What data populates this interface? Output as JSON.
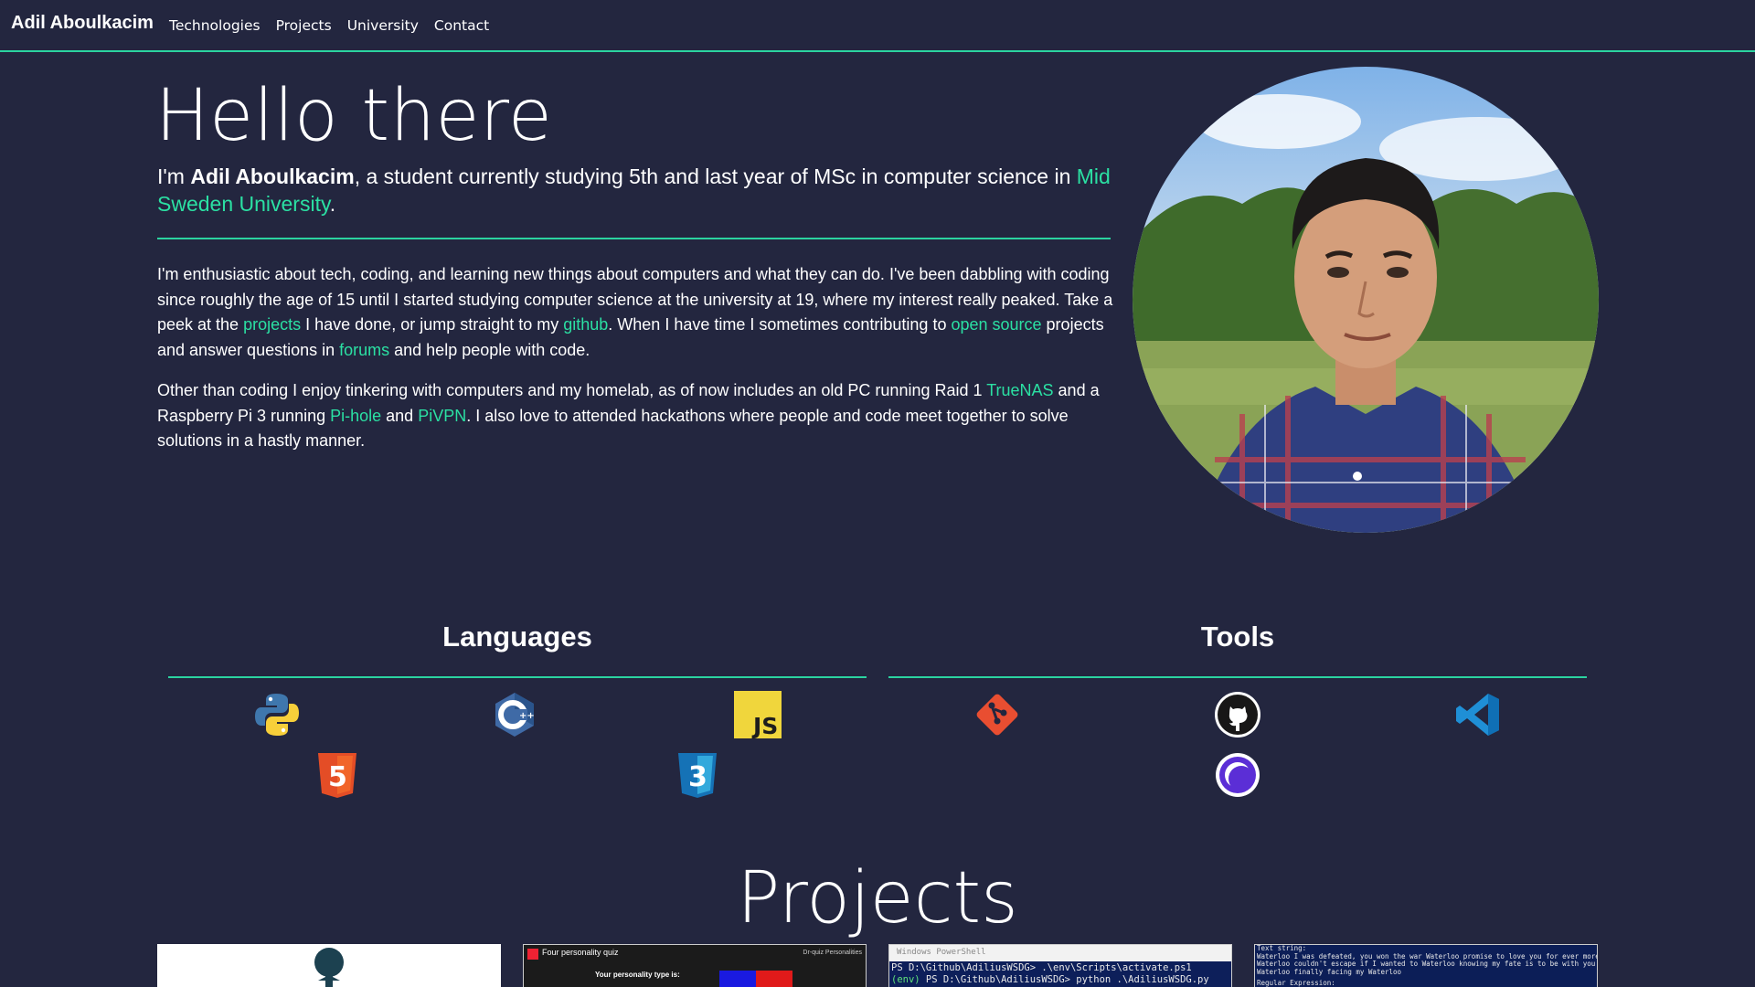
{
  "nav": {
    "brand": "Adil Aboulkacim",
    "links": [
      "Technologies",
      "Projects",
      "University",
      "Contact"
    ]
  },
  "hero": {
    "title": "Hello there",
    "sub_prefix": "I'm ",
    "sub_name": "Adil Aboulkacim",
    "sub_mid": ", a student currently studying 5th and last year of MSc in computer science in ",
    "sub_link": "Mid Sweden University",
    "sub_end": "."
  },
  "about": {
    "p1_a": "I'm enthusiastic about tech, coding, and learning new things about computers and what they can do. I've been dabbling with coding since roughly the age of 15 until I started studying computer science at the university at 19, where my interest really peaked. Take a peek at the ",
    "p1_link1": "projects",
    "p1_b": " I have done, or jump straight to my ",
    "p1_link2": "github",
    "p1_c": ". When I have time I sometimes contributing to ",
    "p1_link3": "open source",
    "p1_d": " projects and answer questions in ",
    "p1_link4": "forums",
    "p1_e": " and help people with code.",
    "p2_a": "Other than coding I enjoy tinkering with computers and my homelab, as of now includes an old PC running Raid 1 ",
    "p2_link1": "TrueNAS",
    "p2_b": " and a Raspberry Pi 3 running ",
    "p2_link2": "Pi-hole",
    "p2_c": " and ",
    "p2_link3": "PiVPN",
    "p2_d": ". I also love to attended hackathons where people and code meet together to solve solutions in a hastly manner."
  },
  "skills": {
    "languages_title": "Languages",
    "tools_title": "Tools",
    "languages": [
      "python-icon",
      "cplusplus-icon",
      "javascript-icon",
      "html5-icon",
      "css3-icon"
    ],
    "tools": [
      "git-icon",
      "github-icon",
      "vscode-icon",
      "circle-icon"
    ]
  },
  "projects": {
    "title": "Projects",
    "thumb2_title": "Four personality quiz",
    "thumb2_right": "Dr-quiz Personalities",
    "thumb2_body": "Your personality type is:",
    "thumb3_header": "Windows PowerShell",
    "thumb3_line1": "PS D:\\Github\\AdiliusWSDG> .\\env\\Scripts\\activate.ps1",
    "thumb3_line2_prefix": "(env)",
    "thumb3_line2": " PS D:\\Github\\AdiliusWSDG> python .\\AdiliusWSDG.py",
    "thumb4_line1": "Text string:",
    "thumb4_line2": "Waterloo I was defeated, you won the war Waterloo promise to love you for ever more",
    "thumb4_line3": " Waterloo couldn't escape if I wanted to Waterloo knowing my fate is to be with you",
    "thumb4_line4": " Waterloo finally facing my Waterloo",
    "thumb4_line5": "Regular Expression:"
  },
  "colors": {
    "background": "#23263f",
    "accent": "#2bd3a0",
    "link": "#2be0a3"
  }
}
